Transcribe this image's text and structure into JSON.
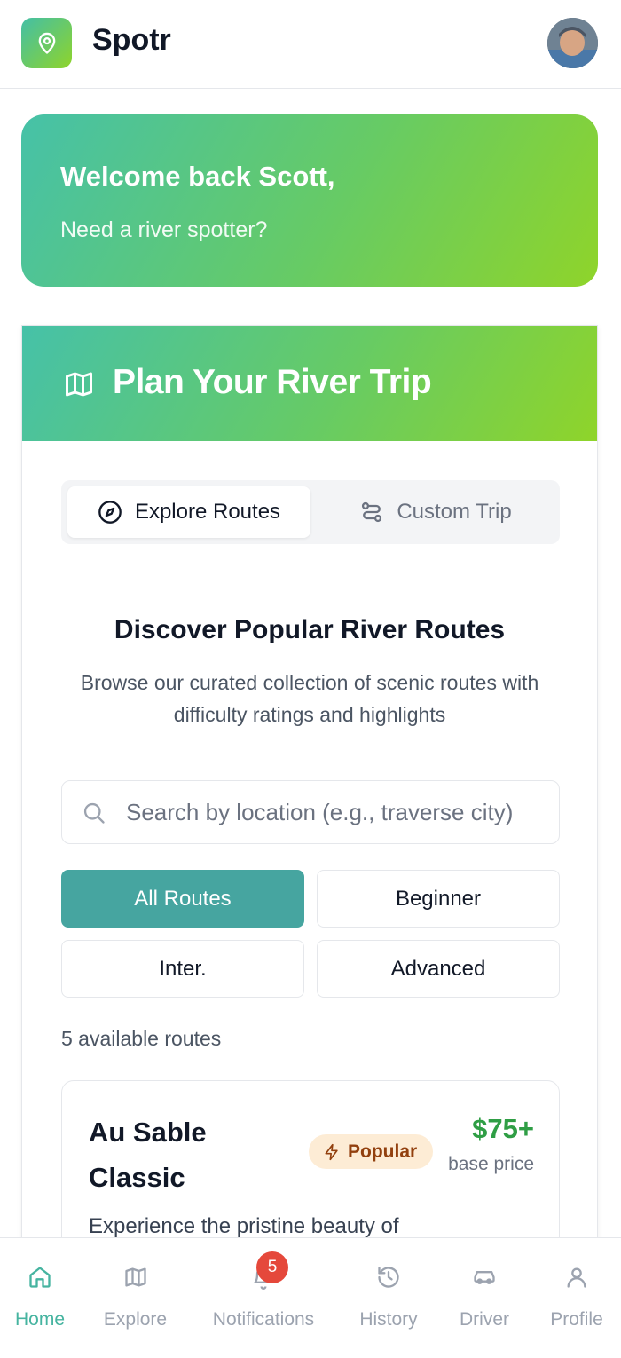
{
  "header": {
    "app_name": "Spotr"
  },
  "welcome": {
    "title": "Welcome back Scott,",
    "subtitle": "Need a river spotter?"
  },
  "plan": {
    "title": "Plan Your River Trip",
    "tabs": [
      {
        "label": "Explore Routes",
        "icon": "compass-icon",
        "active": true
      },
      {
        "label": "Custom Trip",
        "icon": "route-icon",
        "active": false
      }
    ],
    "discover_title": "Discover Popular River Routes",
    "discover_subtitle": "Browse our curated collection of scenic routes with difficulty ratings and highlights",
    "search_placeholder": "Search by location (e.g., traverse city)",
    "filters": [
      {
        "label": "All Routes",
        "active": true
      },
      {
        "label": "Beginner",
        "active": false
      },
      {
        "label": "Inter.",
        "active": false
      },
      {
        "label": "Advanced",
        "active": false
      }
    ],
    "route_count": "5 available routes",
    "routes": [
      {
        "name": "Au Sable Classic",
        "badge": "Popular",
        "price": "$75+",
        "price_label": "base price",
        "description": "Experience the pristine beauty of"
      }
    ]
  },
  "nav": {
    "items": [
      {
        "label": "Home",
        "icon": "home-icon",
        "active": true
      },
      {
        "label": "Explore",
        "icon": "map-icon",
        "active": false
      },
      {
        "label": "Notifications",
        "icon": "bell-icon",
        "active": false,
        "badge": "5"
      },
      {
        "label": "History",
        "icon": "history-icon",
        "active": false
      },
      {
        "label": "Driver",
        "icon": "car-icon",
        "active": false
      },
      {
        "label": "Profile",
        "icon": "user-icon",
        "active": false
      }
    ]
  },
  "colors": {
    "brand_start": "#46c1a8",
    "brand_end": "#8fd42a",
    "accent": "#46a5a0",
    "price": "#2f9e45",
    "badge_bg": "#fdecd5",
    "notif": "#e5483b"
  }
}
